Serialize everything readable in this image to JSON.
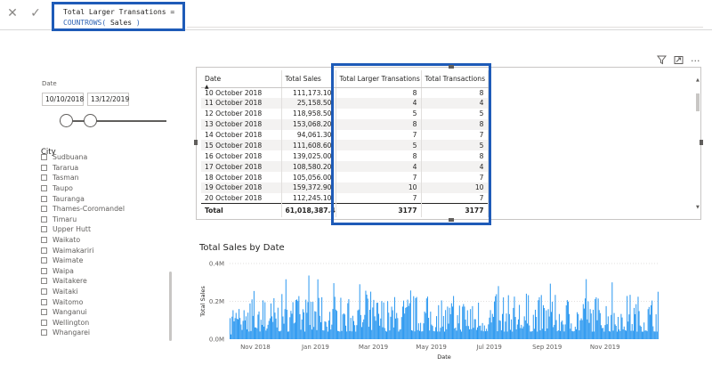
{
  "formula_bar": {
    "cancel_icon": "close-icon",
    "commit_icon": "check-icon",
    "line1": "Total Larger Transations =",
    "line2_fn": "COUNTROWS(",
    "line2_arg": " Sales ",
    "line2_close": ")"
  },
  "date_slicer": {
    "title": "Date",
    "start": "10/10/2018",
    "end": "13/12/2019"
  },
  "city_slicer": {
    "title": "City",
    "items": [
      "Sudbuana",
      "Tararua",
      "Tasman",
      "Taupo",
      "Tauranga",
      "Thames-Coromandel",
      "Timaru",
      "Upper Hutt",
      "Waikato",
      "Waimakariri",
      "Waimate",
      "Waipa",
      "Waitakere",
      "Waitaki",
      "Waitomo",
      "Wanganui",
      "Wellington",
      "Whangarei"
    ]
  },
  "table": {
    "headers": [
      "Date",
      "Total Sales",
      "Total Larger Transations",
      "Total Transactions"
    ],
    "rows": [
      [
        "10 October 2018",
        "111,173.10",
        "8",
        "8"
      ],
      [
        "11 October 2018",
        "25,158.50",
        "4",
        "4"
      ],
      [
        "12 October 2018",
        "118,958.50",
        "5",
        "5"
      ],
      [
        "13 October 2018",
        "153,068.20",
        "8",
        "8"
      ],
      [
        "14 October 2018",
        "94,061.30",
        "7",
        "7"
      ],
      [
        "15 October 2018",
        "111,608.60",
        "5",
        "5"
      ],
      [
        "16 October 2018",
        "139,025.00",
        "8",
        "8"
      ],
      [
        "17 October 2018",
        "108,580.20",
        "4",
        "4"
      ],
      [
        "18 October 2018",
        "105,056.00",
        "7",
        "7"
      ],
      [
        "19 October 2018",
        "159,372.90",
        "10",
        "10"
      ],
      [
        "20 October 2018",
        "112,245.10",
        "7",
        "7"
      ]
    ],
    "total": [
      "Total",
      "61,018,387.40",
      "3177",
      "3177"
    ]
  },
  "toolbar_icons": [
    "filter-icon",
    "focus-mode-icon",
    "more-options-icon"
  ],
  "chart_data": {
    "type": "bar",
    "title": "Total Sales by Date",
    "xlabel": "Date",
    "ylabel": "Total Sales",
    "ylim": [
      0,
      400000
    ],
    "y_ticks": [
      "0.0M",
      "0.2M",
      "0.4M"
    ],
    "x_ticks": [
      "Nov 2018",
      "Jan 2019",
      "Mar 2019",
      "May 2019",
      "Jul 2019",
      "Sep 2019",
      "Nov 2019"
    ],
    "x_range": [
      "2018-10-10",
      "2019-12-13"
    ],
    "series_color": "#2b98f0",
    "values_sample": [
      111173,
      25158,
      118958,
      153068,
      94061,
      111608,
      139025,
      108580,
      105056,
      159372,
      112245
    ]
  }
}
